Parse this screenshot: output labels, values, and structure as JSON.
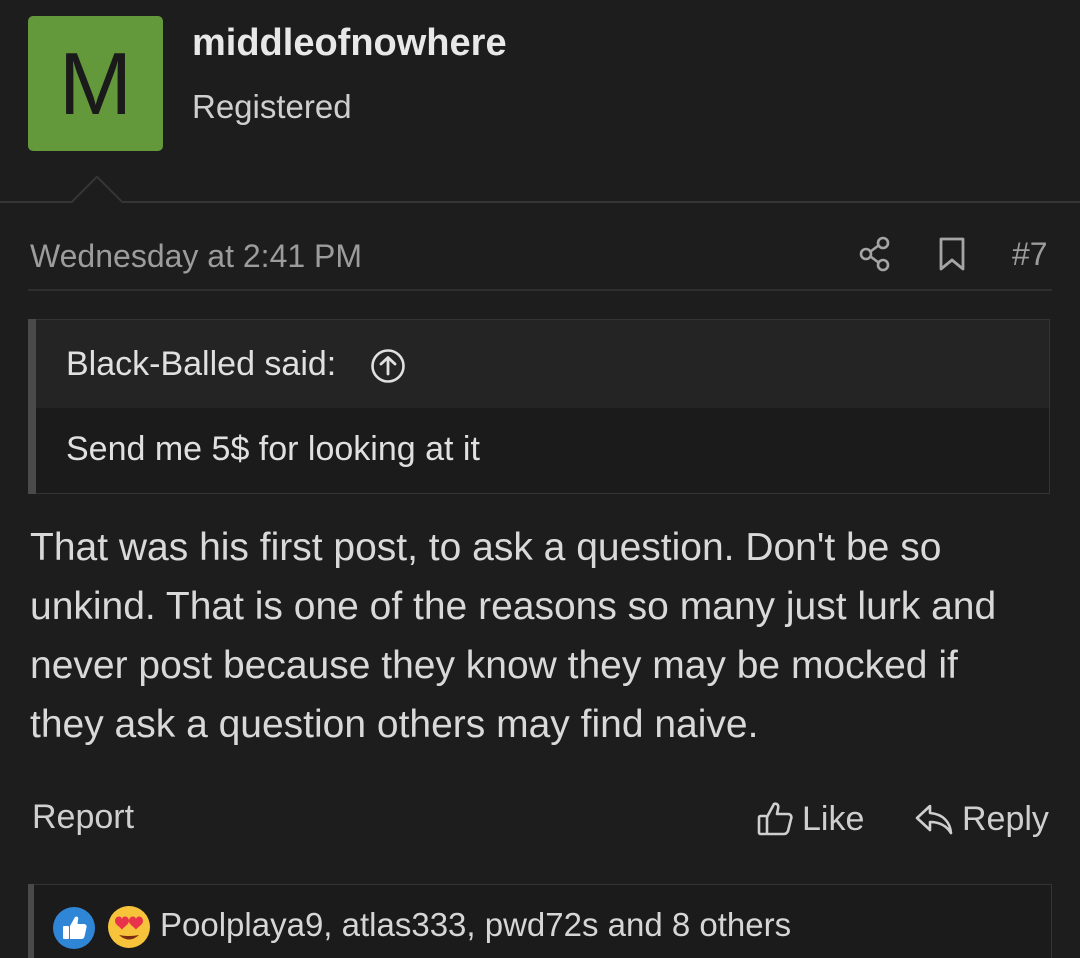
{
  "user": {
    "avatar_letter": "M",
    "avatar_color": "#63993a",
    "username": "middleofnowhere",
    "title": "Registered"
  },
  "post": {
    "date": "Wednesday at 2:41 PM",
    "number": "#7",
    "icons": [
      "share-icon",
      "bookmark-icon"
    ],
    "quote": {
      "author": "Black-Balled said:",
      "text": "Send me 5$ for looking at it"
    },
    "message": "That was his first post, to ask a question. Don't be so unkind. That is one of the reasons so many just lurk and never post because they know they may be mocked if they ask a question others may find naive."
  },
  "actions": {
    "report": "Report",
    "like": "Like",
    "reply": "Reply"
  },
  "reactions": {
    "icons": [
      "like-reaction-icon",
      "love-reaction-icon"
    ],
    "text": "Poolplaya9, atlas333, pwd72s and 8 others"
  }
}
